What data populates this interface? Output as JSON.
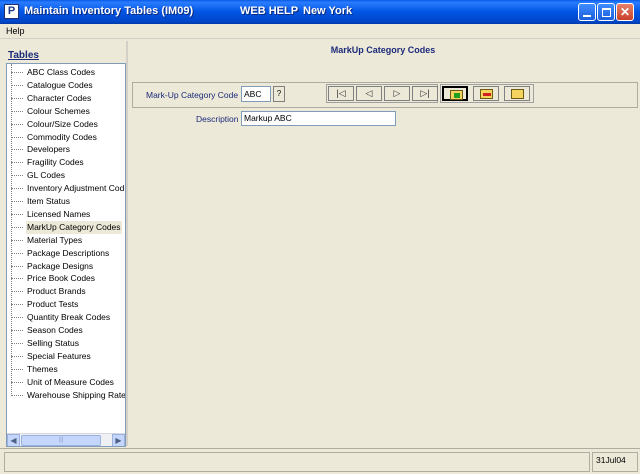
{
  "window": {
    "title": "Maintain Inventory Tables (IM09)",
    "web_help": "WEB HELP",
    "location": "New York",
    "app_icon": "P"
  },
  "menu": {
    "help": "Help"
  },
  "sidebar": {
    "header": "Tables",
    "items": [
      "ABC Class Codes",
      "Catalogue Codes",
      "Character Codes",
      "Colour Schemes",
      "Colour/Size Codes",
      "Commodity Codes",
      "Developers",
      "Fragility Codes",
      "GL Codes",
      "Inventory Adjustment Cod",
      "Item Status",
      "Licensed Names",
      "MarkUp Category Codes",
      "Material Types",
      "Package Descriptions",
      "Package Designs",
      "Price Book Codes",
      "Product Brands",
      "Product Tests",
      "Quantity Break Codes",
      "Season Codes",
      "Selling Status",
      "Special Features",
      "Themes",
      "Unit of Measure Codes",
      "Warehouse Shipping Rate"
    ],
    "selected": "MarkUp Category Codes"
  },
  "main": {
    "title": "MarkUp Category Codes",
    "code_label": "Mark-Up Category Code",
    "code_value": "ABC",
    "lookup_label": "?",
    "description_label": "Description",
    "description_value": "Markup ABC"
  },
  "nav": {
    "first": "|◁",
    "prev": "◁",
    "next": "▷",
    "last": "▷|"
  },
  "status": {
    "date": "31Jul04"
  },
  "icons": [
    "app-icon",
    "minimize-icon",
    "maximize-icon",
    "close-icon",
    "folder-new-icon",
    "folder-delete-icon",
    "folder-icon"
  ]
}
